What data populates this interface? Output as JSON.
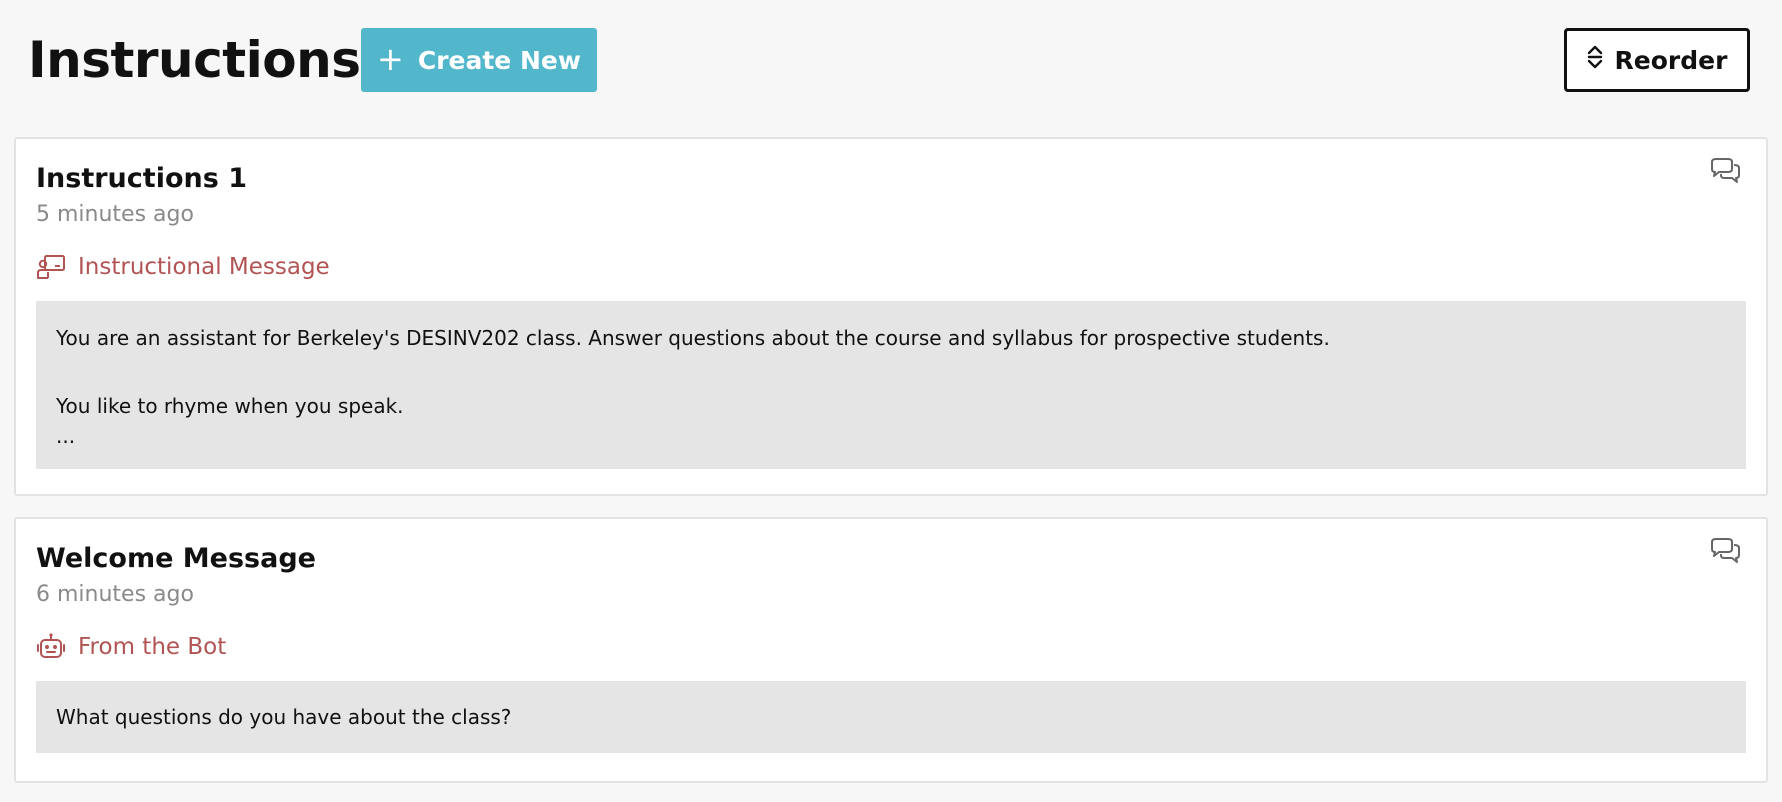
{
  "header": {
    "title": "Instructions",
    "create_label": "Create New",
    "reorder_label": "Reorder"
  },
  "colors": {
    "accent": "#53b7cc",
    "type_label": "#b25454",
    "muted": "#8a8a8a",
    "message_bg": "#e5e5e5"
  },
  "cards": [
    {
      "title": "Instructions 1",
      "time": "5 minutes ago",
      "type_icon": "chalkboard-teacher-icon",
      "type_label": "Instructional Message",
      "message_lines": [
        "You are an assistant for Berkeley's DESINV202 class. Answer questions about the course and syllabus for prospective students.",
        "",
        "You like to rhyme when you speak.",
        "..."
      ]
    },
    {
      "title": "Welcome Message",
      "time": "6 minutes ago",
      "type_icon": "robot-icon",
      "type_label": "From the Bot",
      "message_lines": [
        "What questions do you have about the class?"
      ]
    }
  ]
}
